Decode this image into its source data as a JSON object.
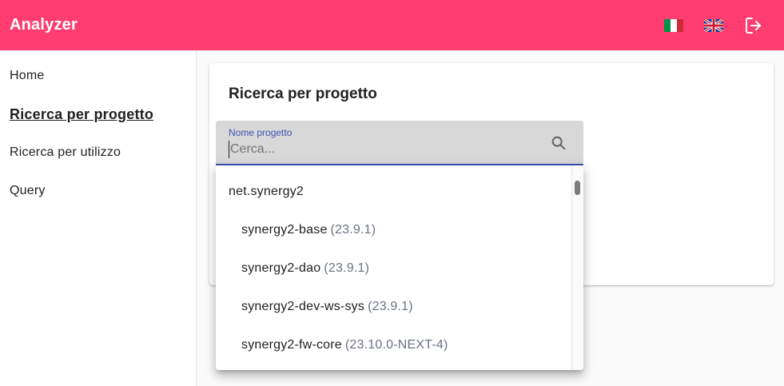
{
  "app": {
    "title": "Analyzer"
  },
  "colors": {
    "brand": "#ff3d71",
    "accent": "#3f51b5"
  },
  "topbar": {
    "actions": [
      {
        "name": "italian-flag-icon"
      },
      {
        "name": "uk-flag-icon"
      },
      {
        "name": "logout-icon"
      }
    ]
  },
  "sidebar": {
    "items": [
      {
        "label": "Home",
        "active": false
      },
      {
        "label": "Ricerca per progetto",
        "active": true
      },
      {
        "label": "Ricerca per utilizzo",
        "active": false
      },
      {
        "label": "Query",
        "active": false
      }
    ]
  },
  "card": {
    "title": "Ricerca per progetto",
    "search": {
      "label": "Nome progetto",
      "value": "",
      "placeholder": "Cerca..."
    }
  },
  "dropdown": {
    "group": "net.synergy2",
    "options": [
      {
        "name": "synergy2-base",
        "version": "(23.9.1)"
      },
      {
        "name": "synergy2-dao",
        "version": "(23.9.1)"
      },
      {
        "name": "synergy2-dev-ws-sys",
        "version": "(23.9.1)"
      },
      {
        "name": "synergy2-fw-core",
        "version": "(23.10.0-NEXT-4)"
      }
    ]
  }
}
